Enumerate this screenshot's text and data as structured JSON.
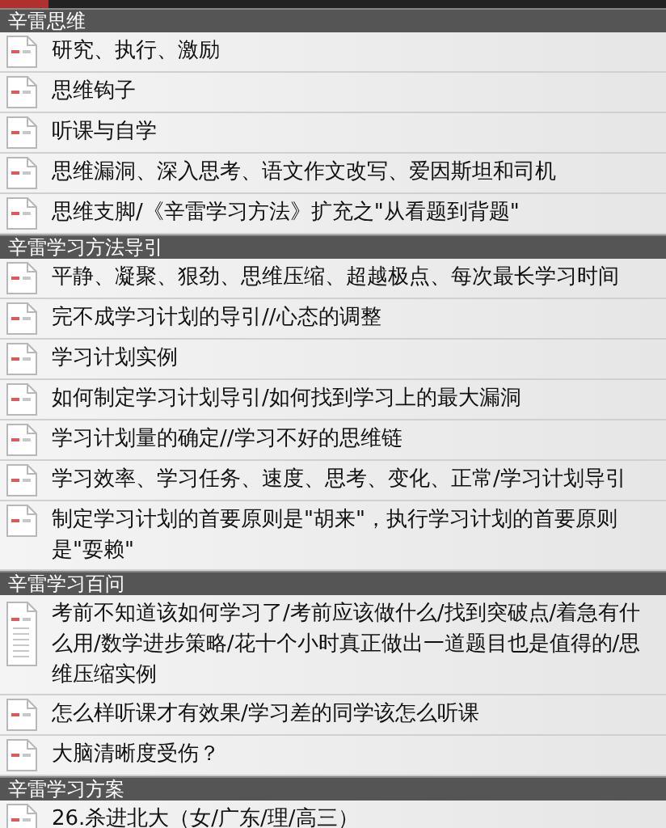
{
  "sections": [
    {
      "title": "辛雷思维",
      "items": [
        {
          "text": "研究、执行、激励"
        },
        {
          "text": "思维钩子"
        },
        {
          "text": "听课与自学"
        },
        {
          "text": "思维漏洞、深入思考、语文作文改写、爱因斯坦和司机"
        },
        {
          "text": "思维支脚/《辛雷学习方法》扩充之\"从看题到背题\""
        }
      ]
    },
    {
      "title": "辛雷学习方法导引",
      "items": [
        {
          "text": "平静、凝聚、狠劲、思维压缩、超越极点、每次最长学习时间"
        },
        {
          "text": "完不成学习计划的导引//心态的调整"
        },
        {
          "text": "学习计划实例"
        },
        {
          "text": "如何制定学习计划导引/如何找到学习上的最大漏洞"
        },
        {
          "text": "学习计划量的确定//学习不好的思维链"
        },
        {
          "text": "学习效率、学习任务、速度、思考、变化、正常/学习计划导引"
        },
        {
          "text": "制定学习计划的首要原则是\"胡来\"，执行学习计划的首要原则是\"耍赖\""
        }
      ]
    },
    {
      "title": "辛雷学习百问",
      "items": [
        {
          "text": "考前不知道该如何学习了/考前应该做什么/找到突破点/着急有什么用/数学进步策略/花十个小时真正做出一道题目也是值得的/思维压缩实例"
        },
        {
          "text": "怎么样听课才有效果/学习差的同学该怎么听课"
        },
        {
          "text": "大脑清晰度受伤？"
        }
      ]
    },
    {
      "title": "辛雷学习方案",
      "items": [
        {
          "text": "26.杀进北大（女/广东/理/高三）"
        }
      ]
    }
  ]
}
